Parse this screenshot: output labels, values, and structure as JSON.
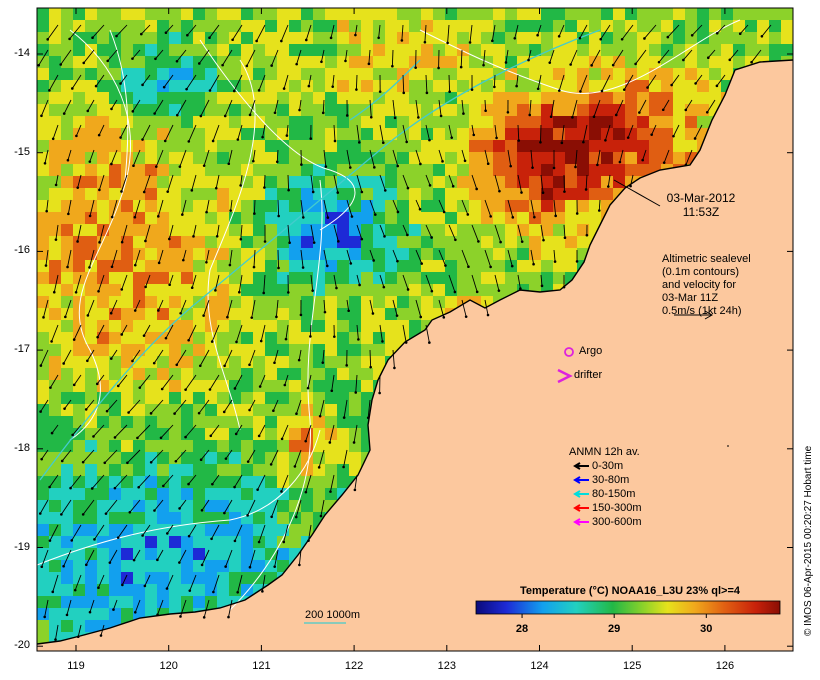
{
  "map": {
    "lat_ticks": [
      "-14",
      "-15",
      "-16",
      "-17",
      "-18",
      "-19",
      "-20"
    ],
    "lon_ticks": [
      "119",
      "120",
      "121",
      "122",
      "123",
      "124",
      "125",
      "126"
    ],
    "extent": {
      "lon": [
        118.65,
        126.7
      ],
      "lat": [
        -20.1,
        -13.6
      ]
    }
  },
  "timestamp": {
    "date": "03-Mar-2012",
    "time": "11:53Z"
  },
  "altimetry_note": [
    "Altimetric sealevel",
    "(0.1m contours)",
    "and velocity for",
    "03-Mar 11Z",
    "0.5m/s (1kt 24h)"
  ],
  "legend_points": {
    "argo": {
      "label": "Argo",
      "color": "#dd22dd"
    },
    "drifter": {
      "label": "drifter",
      "color": "#dd22dd"
    }
  },
  "anmn": {
    "title": "ANMN 12h av.",
    "items": [
      {
        "label": "0-30m",
        "color": "#000000"
      },
      {
        "label": "30-80m",
        "color": "#0000ff"
      },
      {
        "label": "80-150m",
        "color": "#00dddd"
      },
      {
        "label": "150-300m",
        "color": "#ff0000"
      },
      {
        "label": "300-600m",
        "color": "#ff00ff"
      }
    ]
  },
  "bathymetry_legend": {
    "label": "200  1000m"
  },
  "colorbar": {
    "title": "Temperature (°C) NOAA16_L3U 23% ql>=4",
    "ticks": [
      "28",
      "29",
      "30"
    ],
    "range": [
      27.5,
      30.8
    ]
  },
  "credit": "© IMOS 06-Apr-2015 00:20:27 Hobart time",
  "colors": {
    "land": "#fcc89e",
    "coast": "#000000",
    "contour": "#ffffff",
    "bathy_200": "#44cccc"
  }
}
